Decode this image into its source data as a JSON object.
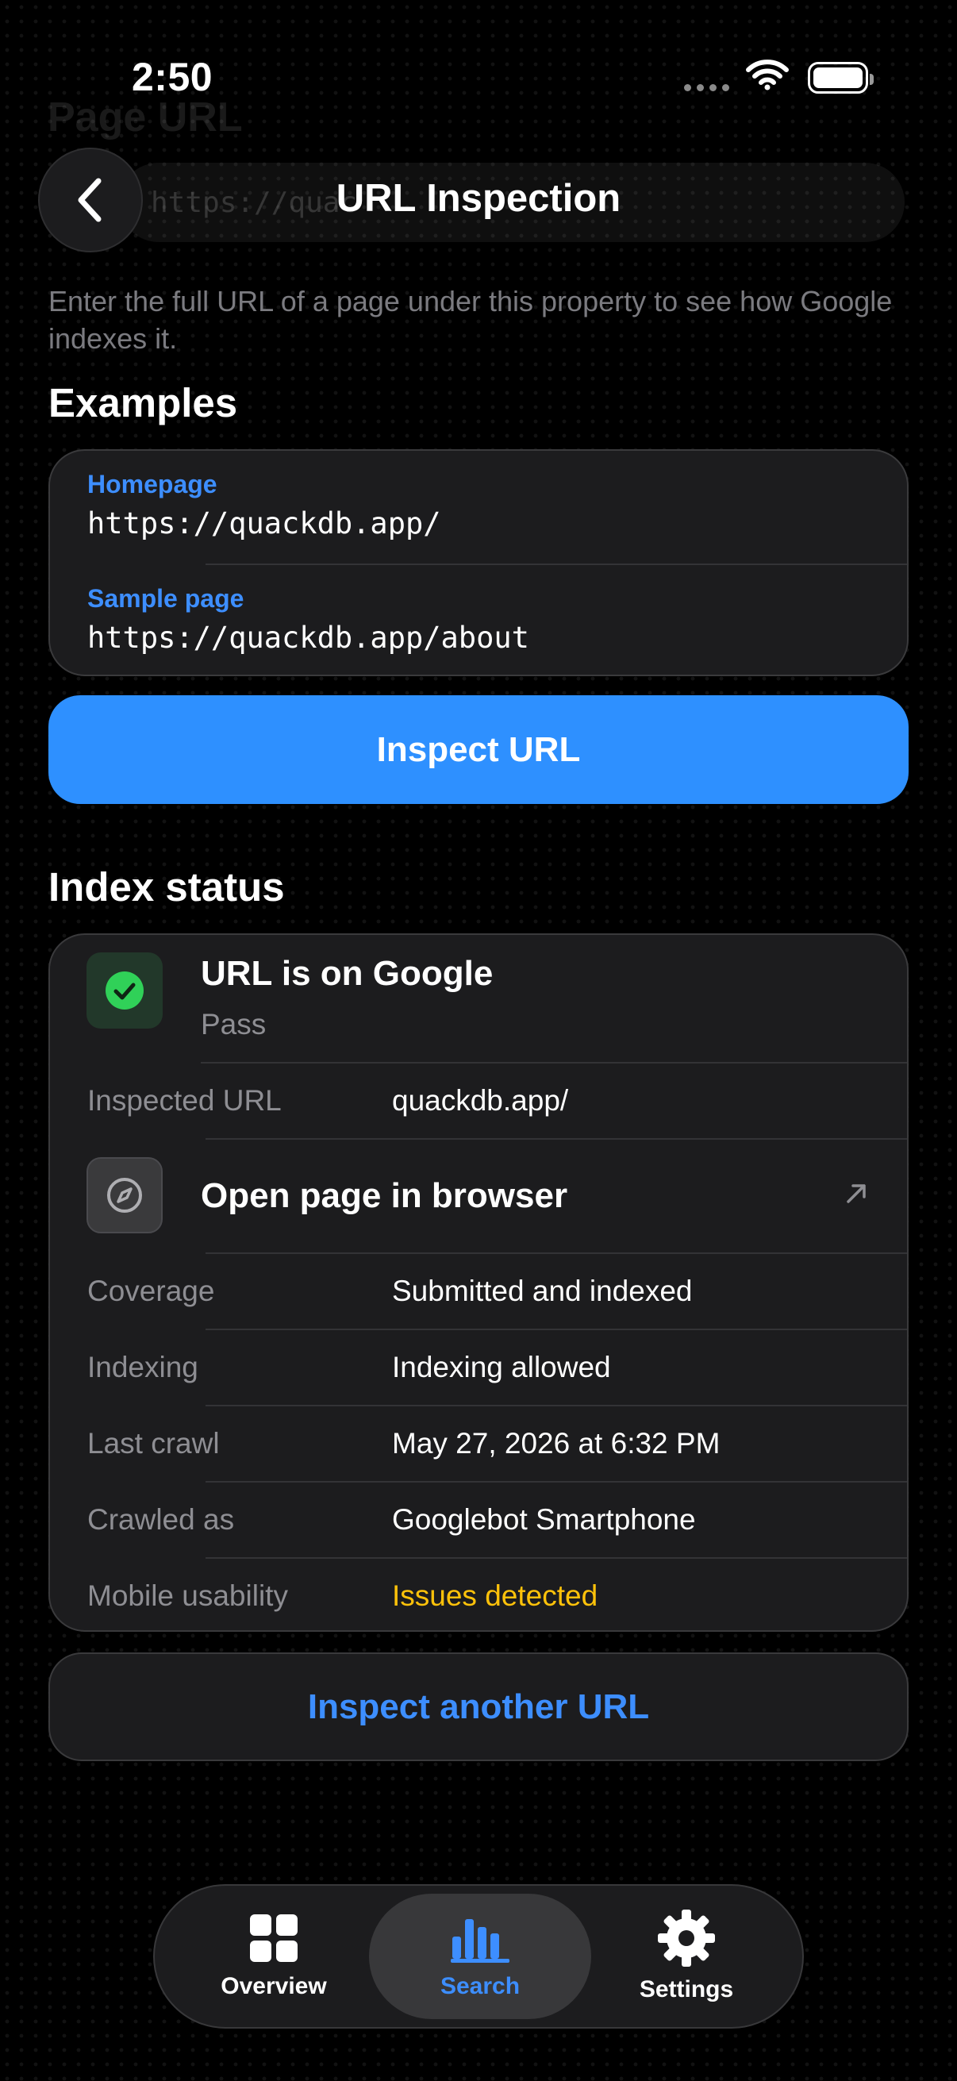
{
  "status_bar": {
    "time": "2:50"
  },
  "background": {
    "title": "Page URL",
    "field_text": "https://quac"
  },
  "header": {
    "title": "URL Inspection"
  },
  "description": "Enter the full URL of a page under this property to see how Google indexes it.",
  "examples": {
    "title": "Examples",
    "items": [
      {
        "label": "Homepage",
        "url": "https://quackdb.app/"
      },
      {
        "label": "Sample page",
        "url": "https://quackdb.app/about"
      }
    ]
  },
  "inspect_button": "Inspect URL",
  "index_status": {
    "title": "Index status",
    "result_title": "URL is on Google",
    "result_subtitle": "Pass",
    "inspected_url_label": "Inspected URL",
    "inspected_url_value": "quackdb.app/",
    "open_browser_label": "Open page in browser",
    "rows": [
      {
        "label": "Coverage",
        "value": "Submitted and indexed"
      },
      {
        "label": "Indexing",
        "value": "Indexing allowed"
      },
      {
        "label": "Last crawl",
        "value": "May 27, 2026 at 6:32 PM"
      },
      {
        "label": "Crawled as",
        "value": "Googlebot Smartphone"
      },
      {
        "label": "Mobile usability",
        "value": "Issues detected"
      }
    ]
  },
  "inspect_another_button": "Inspect another URL",
  "tabs": [
    {
      "label": "Overview",
      "icon": "grid-icon",
      "active": false
    },
    {
      "label": "Search",
      "icon": "bar-chart-icon",
      "active": true
    },
    {
      "label": "Settings",
      "icon": "gear-icon",
      "active": false
    }
  ],
  "colors": {
    "accent": "#2e90ff",
    "link": "#3d8eff",
    "success": "#30d158",
    "warning": "#ffc20a",
    "card": "#1c1c1e"
  }
}
